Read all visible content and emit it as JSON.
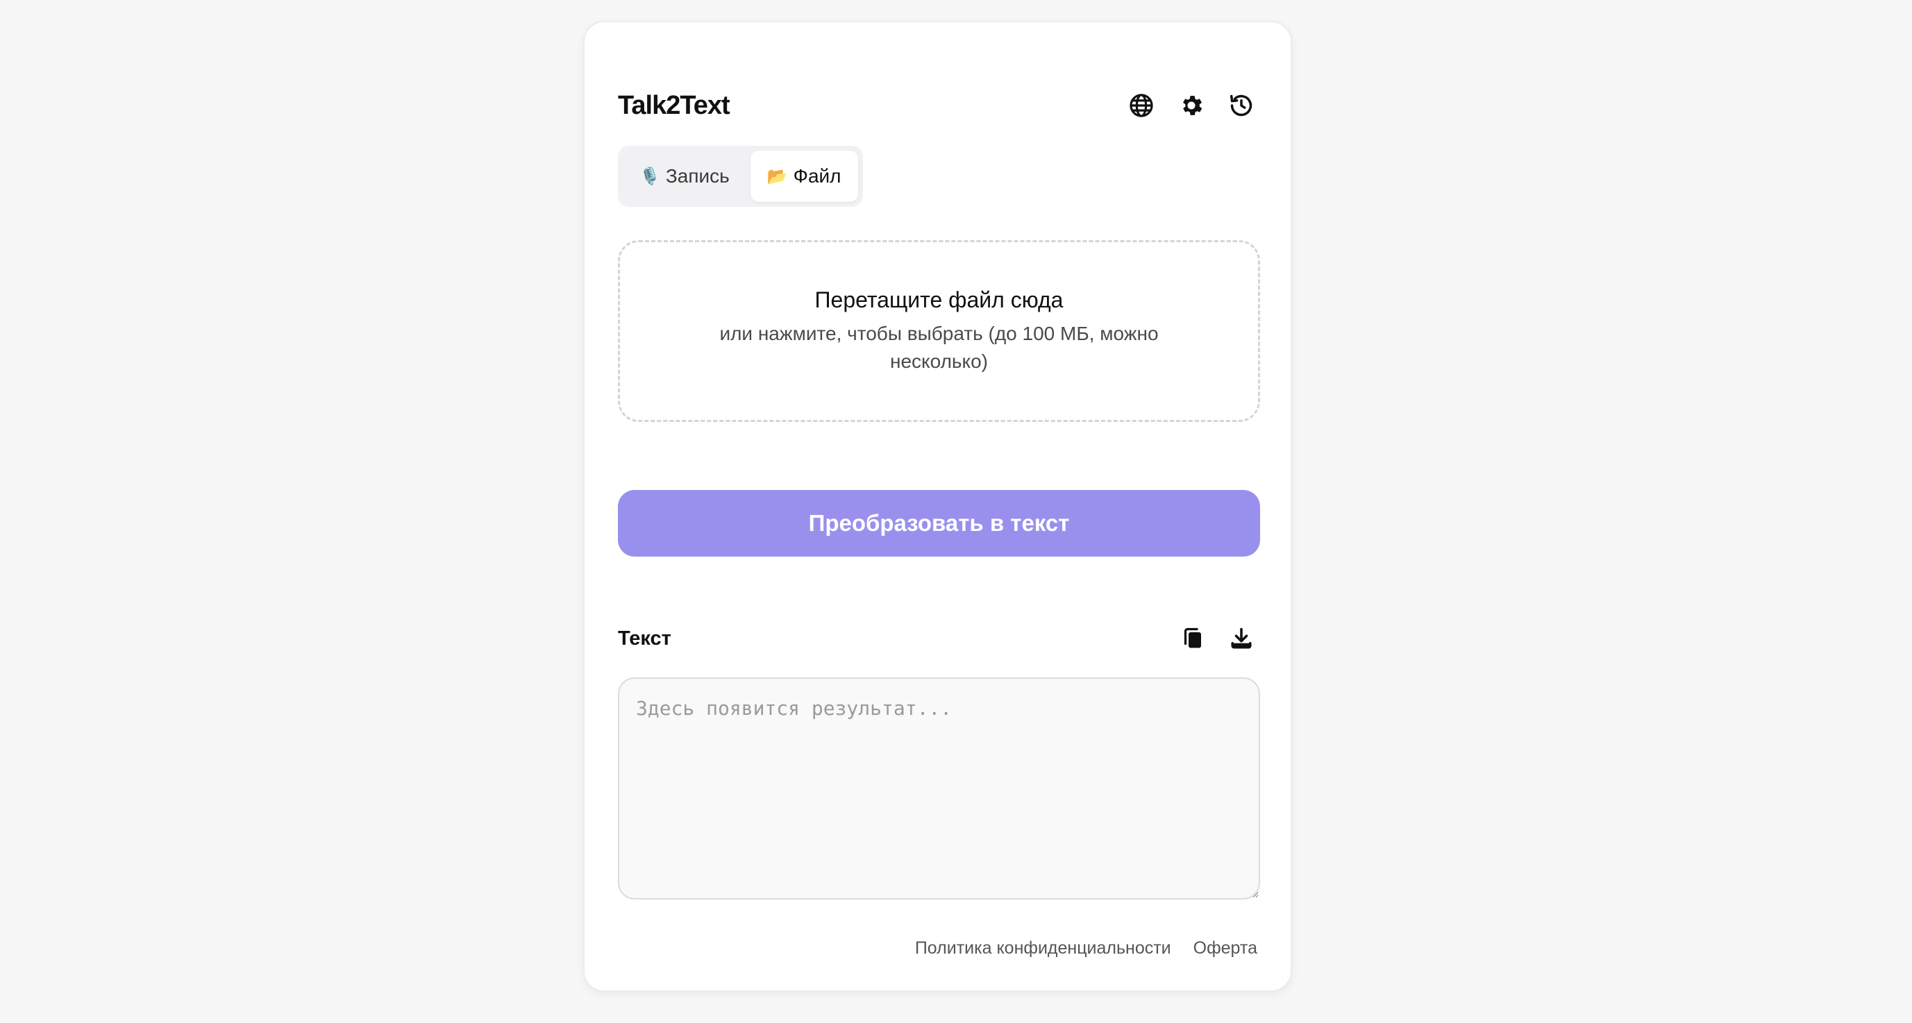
{
  "app": {
    "title": "Talk2Text"
  },
  "header": {
    "icons": [
      "globe-icon",
      "gear-icon",
      "history-icon"
    ]
  },
  "tabs": [
    {
      "emoji": "🎙️",
      "label": "Запись",
      "active": false
    },
    {
      "emoji": "📂",
      "label": "Файл",
      "active": true
    }
  ],
  "dropzone": {
    "title": "Перетащите файл сюда",
    "subtitle": "или нажмите, чтобы выбрать (до 100 МБ, можно несколько)"
  },
  "convert": {
    "label": "Преобразовать в текст"
  },
  "result": {
    "label": "Текст",
    "placeholder": "Здесь появится результат...",
    "value": "",
    "icons": [
      "copy-icon",
      "download-icon"
    ]
  },
  "footer": {
    "privacy": "Политика конфиденциальности",
    "offer": "Оферта"
  },
  "colors": {
    "accent": "#9990ee",
    "background": "#f7f7f7",
    "card": "#ffffff"
  }
}
